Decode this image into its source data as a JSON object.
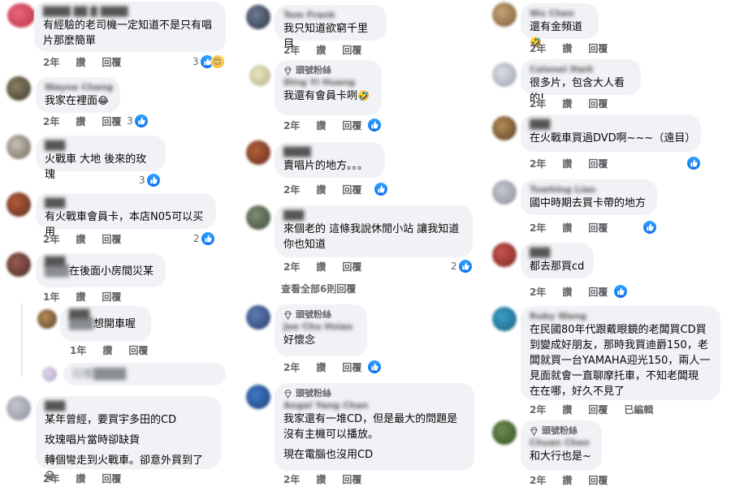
{
  "ui": {
    "time_2y": "2年",
    "time_1y": "1年",
    "like": "讚",
    "reply": "回覆",
    "edited": "已編輯",
    "top_fan_badge": "頭號粉絲",
    "view_all_replies": "查看全部6則回覆"
  },
  "colors": {
    "bubble": "#f0f2f5",
    "meta": "#65676b",
    "like_blue": "#1877f2"
  },
  "column1": {
    "c1": {
      "name": "████ ██ █ ████",
      "text": "有經驗的老司機一定知道不是只有唱\n片那麼簡單",
      "count": "3"
    },
    "c2": {
      "name": "Wayne Chang",
      "text": "我家在裡面",
      "emoji": "😂",
      "count": "3"
    },
    "c3": {
      "name": "███",
      "text": "火戰車 大地 後來的玫瑰",
      "count": "3"
    },
    "c4": {
      "name": "███",
      "text": "有火戰車會員卡，本店N05可以买用",
      "count": "2"
    },
    "c5": {
      "name": "███",
      "name2": "███",
      "text": "在後面小房間災某"
    },
    "c6": {
      "name": "███",
      "name2": "███",
      "text": "想開車喔"
    },
    "c6_reply_placeholder": "回覆████",
    "c7": {
      "name": "███",
      "line1": "某年曾經，要買宇多田的CD",
      "line2": "玫瑰唱片當時卻缺貨",
      "line3": "轉個彎走到火戰車。卻意外買到了",
      "emoji": "😀"
    }
  },
  "column2": {
    "c1": {
      "name": "Tom Frank",
      "text": "我只知道欲窮千里目"
    },
    "c2": {
      "name": "Ding Yi Huang",
      "text": "我還有會員卡咧",
      "emoji": "🤣"
    },
    "c3": {
      "name": "████",
      "text": "賣唱片的地方。。。"
    },
    "c4": {
      "name": "███",
      "text": "來個老的 這條我說休閒小站 讓我知道\n你也知道",
      "count": "2"
    },
    "c5": {
      "name": "Joe Chu Hsiao",
      "text": "好懷念"
    },
    "c6": {
      "name": "Angel Yang Chan",
      "line1": "我家還有一堆CD，但是最大的問題是\n沒有主機可以播放。",
      "line2": "現在電腦也沒用CD"
    }
  },
  "column3": {
    "c1": {
      "name": "Wu Chen",
      "text": "還有金頻道",
      "emoji": "🤣"
    },
    "c2": {
      "name": "Colonel Hwit",
      "text": "很多片，包含大人看的!"
    },
    "c3": {
      "name": "███",
      "text": "在火戰車買過DVD啊~~~（遠目）"
    },
    "c4": {
      "name": "Tuwhing Liao",
      "text": "國中時期去買卡帶的地方"
    },
    "c5": {
      "name": "███",
      "text": "都去那買cd"
    },
    "c6": {
      "name": "Ruby Wang",
      "text": "在民國80年代跟戴眼鏡的老闆買CD買\n到變成好朋友，那時我買迪爵150，老\n闆就買一台YAMAHA迎光150，兩人一\n見面就會一直聊摩托車，不知老闆現\n在在哪，好久不見了"
    },
    "c7": {
      "name": "Chuan Chen",
      "text": "和大行也是~"
    }
  }
}
